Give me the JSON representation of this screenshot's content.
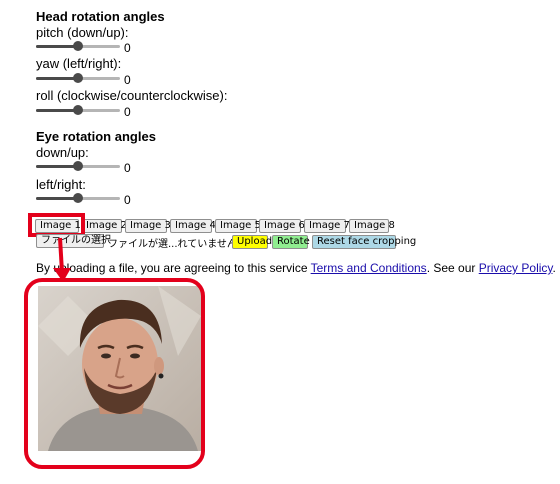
{
  "head": {
    "title": "Head rotation angles",
    "sliders": [
      {
        "label": "pitch (down/up):",
        "value": "0",
        "level": 0.5
      },
      {
        "label": "yaw (left/right):",
        "value": "0",
        "level": 0.5
      },
      {
        "label": "roll (clockwise/counterclockwise):",
        "value": "0",
        "level": 0.5
      }
    ]
  },
  "eye": {
    "title": "Eye rotation angles",
    "sliders": [
      {
        "label": "down/up:",
        "value": "0",
        "level": 0.5
      },
      {
        "label": "left/right:",
        "value": "0",
        "level": 0.5
      }
    ]
  },
  "image_buttons": [
    "Image 1",
    "Image 2",
    "Image 3",
    "Image 4",
    "Image 5",
    "Image 6",
    "Image 7",
    "Image 8"
  ],
  "file": {
    "choose_label": "ファイルの選択",
    "status": "ファイルが選...れていません"
  },
  "actions": {
    "upload": "Upload",
    "rotate": "Rotate",
    "reset": "Reset face cropping"
  },
  "colors": {
    "upload": "#ffff00",
    "rotate": "#90ee90",
    "reset": "#add8e6",
    "highlight": "#e3001b",
    "link": "#1a0dab"
  },
  "notice": {
    "pre": "By uploading a file, you are agreeing to this service ",
    "terms": "Terms and Conditions",
    "mid": ". See our ",
    "privacy": "Privacy Policy",
    "post": "."
  }
}
